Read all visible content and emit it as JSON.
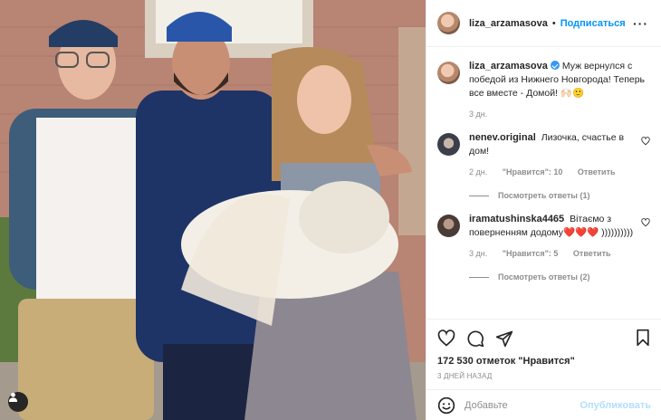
{
  "post": {
    "author": "liza_arzamasova",
    "follow_label": "Подписаться",
    "more_icon": "more-horizontal-icon",
    "caption": {
      "username": "liza_arzamasova",
      "text": "Муж вернулся с победой из Нижнего Новгорода! Теперь все вместе - Домой! 🙌🏻🙂",
      "time": "3 дн."
    },
    "comments": [
      {
        "username": "nenev.original",
        "text": "Лизочка, счастье в дом!",
        "time": "2 дн.",
        "likes": "\"Нравится\": 10",
        "reply": "Ответить",
        "view_replies": "Посмотреть ответы (1)"
      },
      {
        "username": "iramatushinska4465",
        "text": "Вітаємо з поверненням додому❤️❤️❤️ ))))))))))",
        "time": "3 дн.",
        "likes": "\"Нравится\": 5",
        "reply": "Ответить",
        "view_replies": "Посмотреть ответы (2)"
      }
    ],
    "likes_count": "172 530 отметок \"Нравится\"",
    "posted_ago": "3 ДНЕЙ НАЗАД",
    "add_comment_placeholder": "Добавьте",
    "publish_label": "Опубликовать"
  },
  "colors": {
    "link_blue": "#0095f6",
    "muted": "#8e8e8e",
    "publish_disabled": "#b2dffc",
    "heart_red": "#ed4956"
  }
}
